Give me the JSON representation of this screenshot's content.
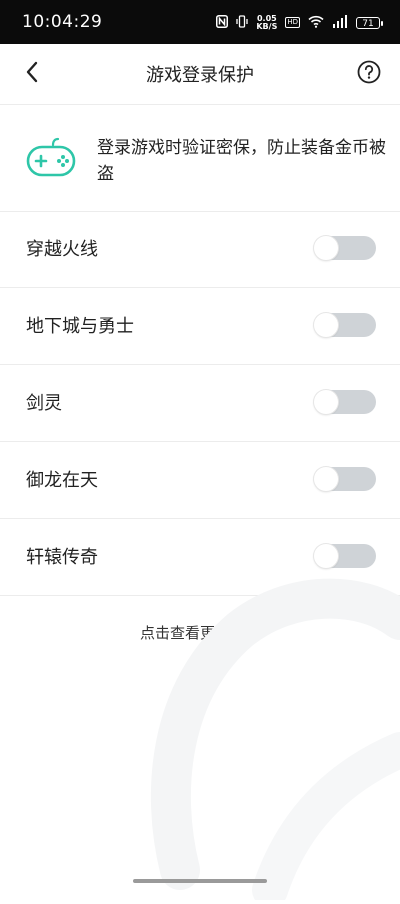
{
  "status_bar": {
    "time": "10:04:29",
    "net_speed_value": "0.05",
    "net_speed_unit": "KB/S",
    "hd_label": "HD",
    "battery_level": "71"
  },
  "header": {
    "title": "游戏登录保护",
    "back_icon": "chevron-left-icon",
    "help_icon": "question-circle-icon"
  },
  "intro": {
    "icon": "gamepad-icon",
    "text": "登录游戏时验证密保，防止装备金币被盗",
    "accent_color": "#2ec6a8"
  },
  "games": [
    {
      "name": "穿越火线",
      "enabled": false
    },
    {
      "name": "地下城与勇士",
      "enabled": false
    },
    {
      "name": "剑灵",
      "enabled": false
    },
    {
      "name": "御龙在天",
      "enabled": false
    },
    {
      "name": "轩辕传奇",
      "enabled": false
    }
  ],
  "more_link": "点击查看更多游戏"
}
